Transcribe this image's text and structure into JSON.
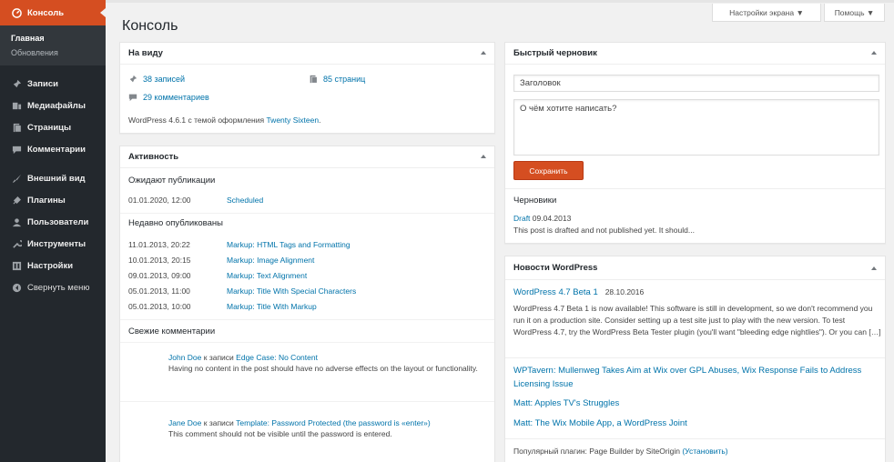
{
  "sidebar": {
    "head": {
      "label": "Консоль",
      "icon": "dashboard-icon"
    },
    "sub": [
      {
        "label": "Главная"
      },
      {
        "label": "Обновления"
      }
    ],
    "items": [
      {
        "label": "Записи",
        "icon": "pin-icon"
      },
      {
        "label": "Медиафайлы",
        "icon": "media-icon"
      },
      {
        "label": "Страницы",
        "icon": "pages-icon"
      },
      {
        "label": "Комментарии",
        "icon": "comment-icon"
      },
      {
        "label": "Внешний вид",
        "icon": "brush-icon"
      },
      {
        "label": "Плагины",
        "icon": "plugin-icon"
      },
      {
        "label": "Пользователи",
        "icon": "user-icon"
      },
      {
        "label": "Инструменты",
        "icon": "wrench-icon"
      },
      {
        "label": "Настройки",
        "icon": "settings-icon"
      },
      {
        "label": "Свернуть меню",
        "icon": "collapse-icon"
      }
    ]
  },
  "header": {
    "title": "Консоль",
    "screen_options": "Настройки экрана ▼",
    "help": "Помощь ▼"
  },
  "glance": {
    "title": "На виду",
    "posts": "38 записей",
    "pages": "85 страниц",
    "comments": "29 комментариев",
    "version_text": "WordPress 4.6.1 с темой оформления ",
    "theme": "Twenty Sixteen",
    "version_end": "."
  },
  "activity": {
    "title": "Активность",
    "scheduled_title": "Ожидают публикации",
    "scheduled": [
      {
        "date": "01.01.2020, 12:00",
        "title": "Scheduled"
      }
    ],
    "recent_title": "Недавно опубликованы",
    "recent": [
      {
        "date": "11.01.2013, 20:22",
        "title": "Markup: HTML Tags and Formatting"
      },
      {
        "date": "10.01.2013, 20:15",
        "title": "Markup: Image Alignment"
      },
      {
        "date": "09.01.2013, 09:00",
        "title": "Markup: Text Alignment"
      },
      {
        "date": "05.01.2013, 11:00",
        "title": "Markup: Title With Special Characters"
      },
      {
        "date": "05.01.2013, 10:00",
        "title": "Markup: Title With Markup"
      }
    ],
    "comments_title": "Свежие комментарии",
    "comments": [
      {
        "author": "John Doe",
        "to": " к записи ",
        "post": "Edge Case: No Content",
        "text": "Having no content in the post should have no adverse effects on the layout or functionality."
      },
      {
        "author": "Jane Doe",
        "to": " к записи ",
        "post": "Template: Password Protected (the password is «enter»)",
        "text": "This comment should not be visible until the password is entered."
      }
    ]
  },
  "draft": {
    "title": "Быстрый черновик",
    "title_placeholder": "Заголовок",
    "content_placeholder": "О чём хотите написать?",
    "save": "Сохранить",
    "drafts_title": "Черновики",
    "draft_link": "Draft",
    "draft_date": " 09.04.2013",
    "draft_excerpt": "This post is drafted and not published yet. It should..."
  },
  "news": {
    "title": "Новости WordPress",
    "main_link": "WordPress 4.7 Beta 1",
    "main_date": "28.10.2016",
    "main_excerpt": "WordPress 4.7 Beta 1 is now available! This software is still in development, so we don't recommend you run it on a production site. Consider setting up a test site just to play with the new version. To test WordPress 4.7, try the WordPress Beta Tester plugin (you'll want \"bleeding edge nightlies\"). Or you can […]",
    "links": [
      "WPTavern: Mullenweg Takes Aim at Wix over GPL Abuses, Wix Response Fails to Address Licensing Issue",
      "Matt: Apples TV's Struggles",
      "Matt: The Wix Mobile App, a WordPress Joint"
    ],
    "footer_text": "Популярный плагин: Page Builder by SiteOrigin ",
    "footer_link": "(Установить)"
  },
  "colors": {
    "accent": "#0073aa",
    "sidebar": "#23282d",
    "save_button": "#d54e21"
  }
}
